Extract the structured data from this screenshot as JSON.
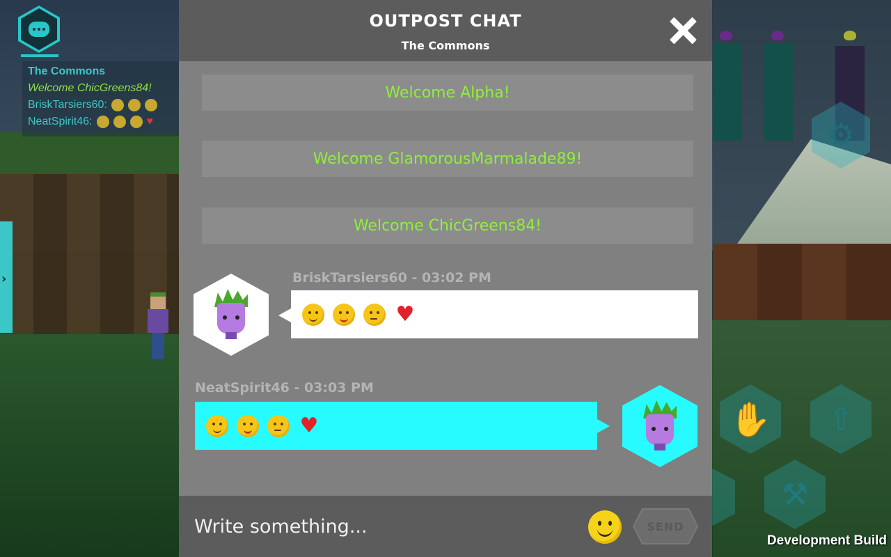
{
  "hud": {
    "chat_button_icon": "chat-bubble-icon",
    "mini_chat": {
      "title": "The Commons",
      "welcome": "Welcome ChicGreens84!",
      "line1_user": "BriskTarsiers60:",
      "line2_user": "NeatSpirit46:"
    },
    "settings_icon": "gears-icon",
    "hand_icon": "hand-icon",
    "spawn_icon": "spawn-icon",
    "hammer_icon": "hammer-icon",
    "dev_build": "Development Build"
  },
  "chat": {
    "title": "OUTPOST CHAT",
    "subtitle": "The Commons",
    "close_icon": "close-icon",
    "system_messages": [
      "Welcome Alpha!",
      "Welcome GlamorousMarmalade89!",
      "Welcome ChicGreens84!"
    ],
    "messages": [
      {
        "meta": "BriskTarsiers60 - 03:02 PM",
        "emojis": [
          "slightly-smiling-face",
          "face-with-tongue",
          "sick-face",
          "heart"
        ]
      },
      {
        "meta": "NeatSpirit46 - 03:03 PM",
        "emojis": [
          "slightly-smiling-face",
          "face-with-tongue",
          "sick-face",
          "heart"
        ]
      }
    ],
    "input": {
      "placeholder": "Write something..."
    },
    "emoji_button_icon": "smiley-icon",
    "send_label": "SEND"
  },
  "colors": {
    "accent_cyan": "#27fbff",
    "system_green": "#8ef03a",
    "panel_bg": "#808080",
    "header_bg": "#5c5c5c"
  }
}
